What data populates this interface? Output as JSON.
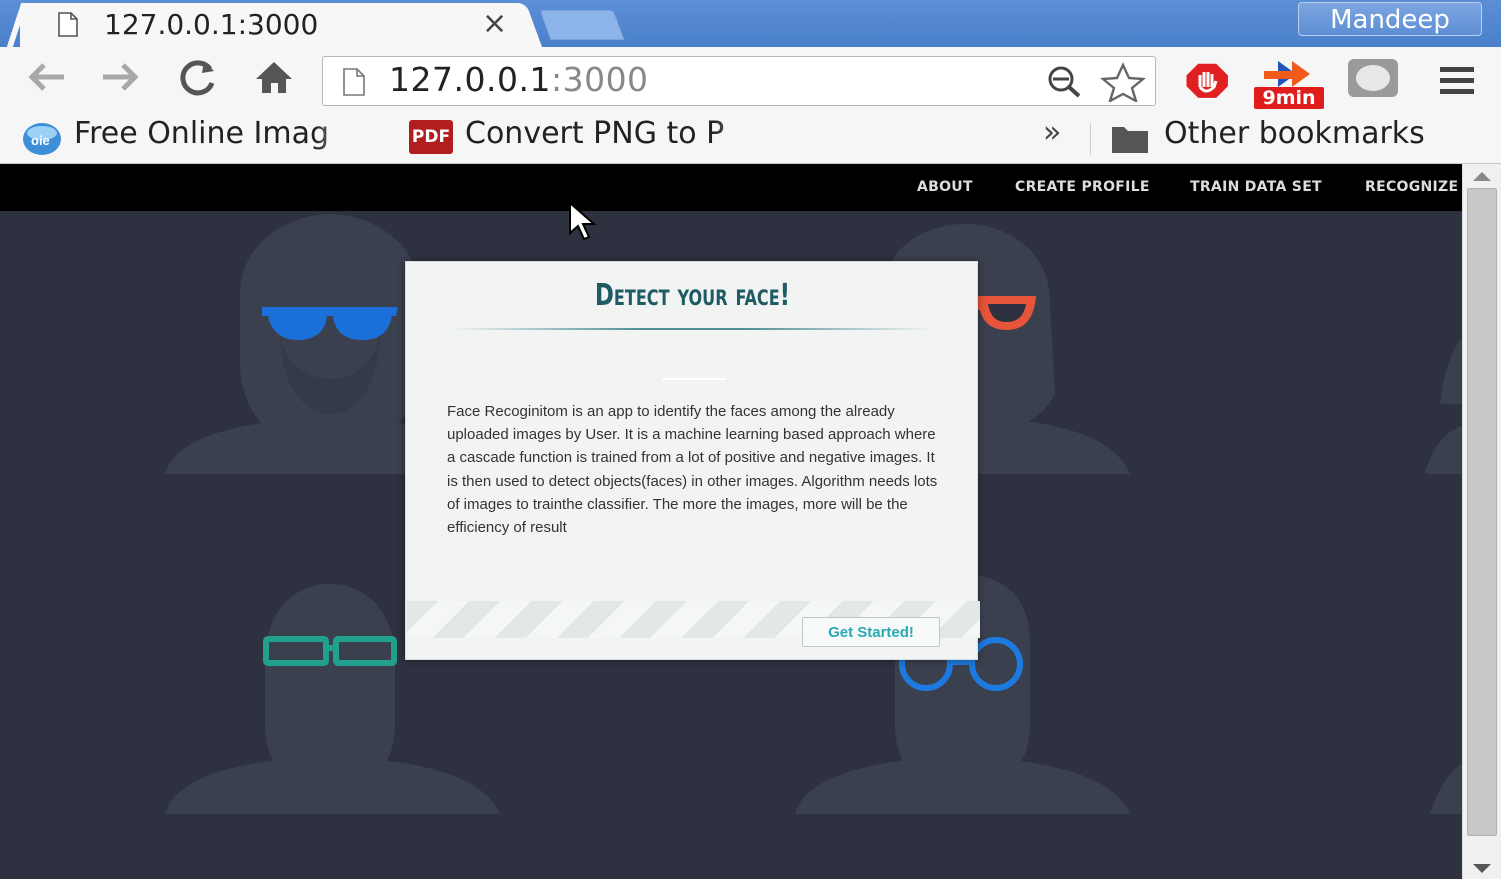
{
  "browser": {
    "tab_title": "127.0.0.1:3000",
    "tab_close": "×",
    "profile_name": "Mandeep",
    "url_host": "127.0.0.1",
    "url_port": ":3000",
    "extension_badge": "9min",
    "bookmarks": [
      {
        "label": "Free Online Imag",
        "icon": "online-image-icon"
      },
      {
        "label": "Convert PNG to P",
        "icon": "pdf-icon",
        "icon_text": "PDF"
      }
    ],
    "bookmarks_overflow": "»",
    "other_bookmarks": "Other bookmarks"
  },
  "nav": {
    "items": [
      "ABOUT",
      "CREATE PROFILE",
      "TRAIN DATA SET",
      "RECOGNIZE"
    ]
  },
  "modal": {
    "title": "Detect your face!",
    "body": "Face Recoginitom is an app to identify the faces among the already uploaded images by User. It is a machine learning based approach where a cascade function is trained from a lot of positive and negative images. It is then used to detect objects(faces) in other images. Algorithm needs lots of images to trainthe classifier. The more the images, more will be the efficiency of result",
    "button": "Get Started!"
  },
  "colors": {
    "page_bg": "#2e3140",
    "silhouette": "#3c4150",
    "title": "#1f5b63",
    "button_text": "#2aa9b3",
    "glasses_blue": "#1a6fd8",
    "glasses_red": "#e6543a",
    "glasses_teal": "#21a08e",
    "glasses_round_blue": "#1d7ae0"
  }
}
